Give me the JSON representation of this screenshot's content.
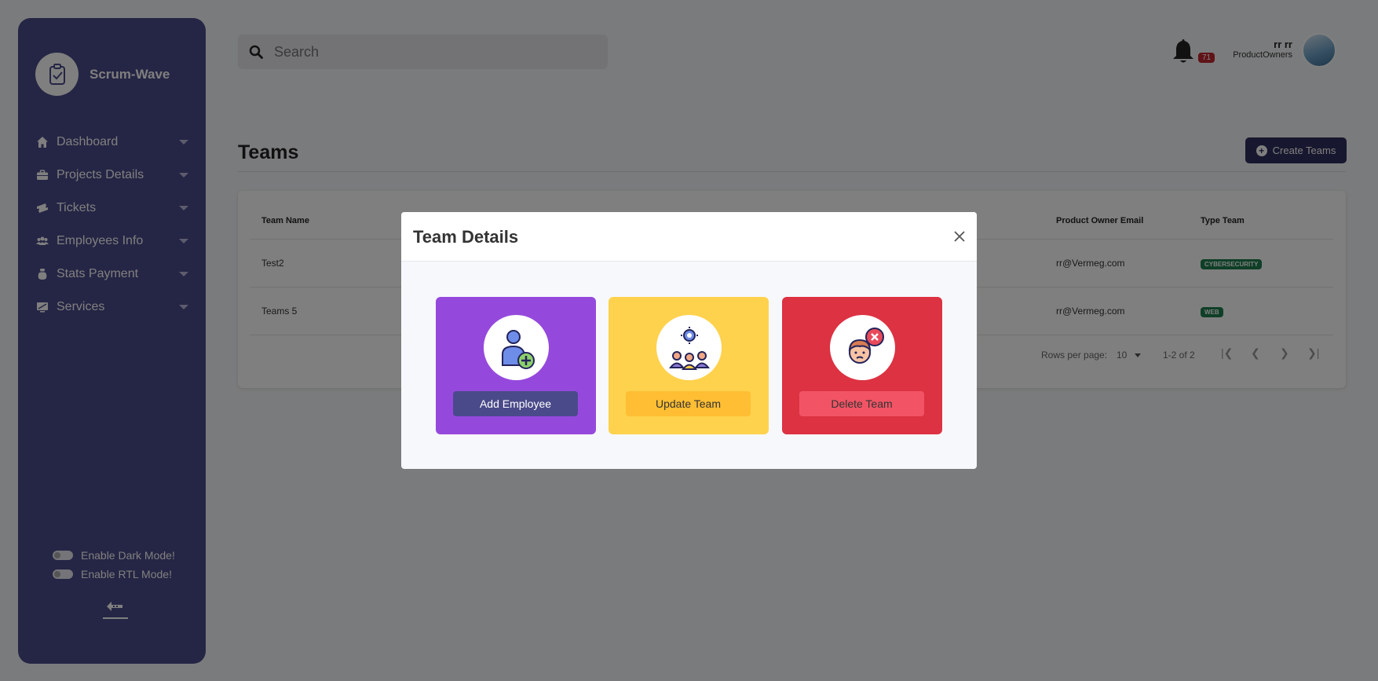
{
  "app": {
    "name": "Scrum-Wave"
  },
  "sidebar": {
    "items": [
      {
        "label": "Dashboard",
        "icon": "home-icon"
      },
      {
        "label": "Projects Details",
        "icon": "briefcase-icon"
      },
      {
        "label": "Tickets",
        "icon": "ticket-icon"
      },
      {
        "label": "Employees Info",
        "icon": "users-icon"
      },
      {
        "label": "Stats Payment",
        "icon": "money-bag-icon"
      },
      {
        "label": "Services",
        "icon": "monitor-icon"
      }
    ],
    "dark_mode_label": "Enable Dark Mode!",
    "rtl_mode_label": "Enable RTL Mode!"
  },
  "header": {
    "search_placeholder": "Search",
    "notifications_count": "71",
    "user_name": "rr rr",
    "user_role": "ProductOwners"
  },
  "page": {
    "title": "Teams",
    "create_button": "Create Teams"
  },
  "table": {
    "columns": [
      "Team Name",
      "Product Owner Email",
      "Type Team"
    ],
    "rows": [
      {
        "name": "Test2",
        "email": "rr@Vermeg.com",
        "type": "CYBERSECURITY"
      },
      {
        "name": "Teams 5",
        "email": "rr@Vermeg.com",
        "type": "WEB"
      }
    ],
    "rows_per_page_label": "Rows per page:",
    "rows_per_page_value": "10",
    "range": "1-2 of 2"
  },
  "modal": {
    "title": "Team Details",
    "actions": [
      {
        "label": "Add Employee",
        "icon": "add-employee-icon",
        "color": "#9549dc",
        "button_color": "#4a4a8a"
      },
      {
        "label": "Update Team",
        "icon": "team-update-icon",
        "color": "#ffd24d",
        "button_color": "#ffbe33"
      },
      {
        "label": "Delete Team",
        "icon": "delete-user-icon",
        "color": "#dc3242",
        "button_color": "#f25465"
      }
    ]
  }
}
